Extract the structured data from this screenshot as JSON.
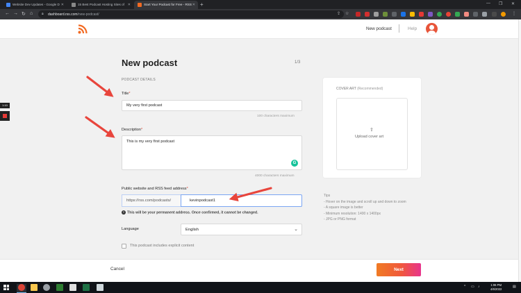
{
  "browser": {
    "tabs": [
      {
        "title": "Website Dev Updates - Google D",
        "favicon_color": "#4285f4"
      },
      {
        "title": "15 Best Podcast Hosting Sites of",
        "favicon_color": "#888888"
      },
      {
        "title": "Start Your Podcast for Free - RSS",
        "favicon_color": "#f26a22"
      }
    ],
    "url_host": "dashboard.rss.com",
    "url_path": "/new-podcast/"
  },
  "header": {
    "new_podcast": "New podcast",
    "help": "Help"
  },
  "form": {
    "title": "New podcast",
    "step": "1/3",
    "section": "PODCAST DETAILS",
    "title_field": {
      "label": "Title",
      "value": "My very first podcast",
      "hint": "100 characters maximum"
    },
    "description_field": {
      "label": "Description",
      "value": "This is my very first podcast",
      "hint": "4000 characters maximum"
    },
    "url_field": {
      "label": "Public website and RSS feed address",
      "prefix": "https://rss.com/podcasts/",
      "value": "kevinpodcast1"
    },
    "permanent_warning": "This will be your permanent address. Once confirmed, it cannot be changed.",
    "language": {
      "label": "Language",
      "value": "English"
    },
    "explicit_label": "This podcast includes explicit content",
    "required_mark": "*"
  },
  "cover_art": {
    "title": "COVER ART",
    "recommended": "(Recommended)",
    "upload_label": "Upload cover art",
    "tips_title": "Tips",
    "tips": [
      "- Hover on the image and scroll up and down to zoom",
      "- A square image is better",
      "- Minimum resolution: 1400 x 1400px",
      "- JPG or PNG format"
    ]
  },
  "footer": {
    "cancel": "Cancel",
    "next": "Next"
  },
  "recorder": {
    "time": "1:10"
  },
  "taskbar": {
    "time": "1:06 PM",
    "date": "4/6/2022"
  },
  "colors": {
    "brand_orange": "#f26a22",
    "next_gradient": [
      "#f07b24",
      "#e8348c"
    ],
    "annotation_arrow": "#e8453c"
  }
}
